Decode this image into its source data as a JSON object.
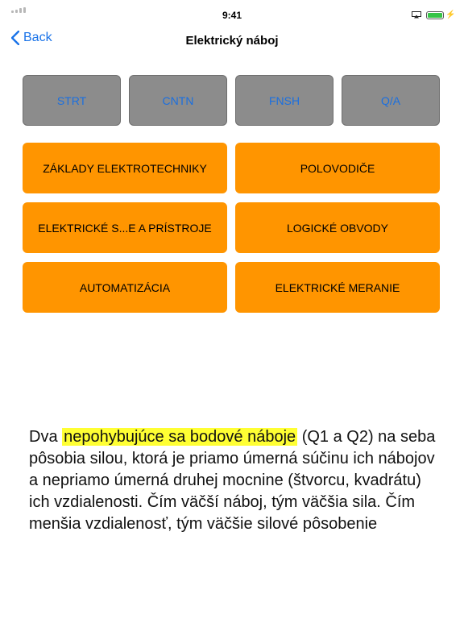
{
  "status_bar": {
    "time": "9:41"
  },
  "nav": {
    "back_label": "Back",
    "title": "Elektrický náboj"
  },
  "top_buttons": [
    {
      "label": "STRT"
    },
    {
      "label": "CNTN"
    },
    {
      "label": "FNSH"
    },
    {
      "label": "Q/A"
    }
  ],
  "categories": [
    {
      "label": "ZÁKLADY ELEKTROTECHNIKY"
    },
    {
      "label": "POLOVODIČE"
    },
    {
      "label": "ELEKTRICKÉ S...E A PRÍSTROJE"
    },
    {
      "label": "LOGICKÉ OBVODY"
    },
    {
      "label": "AUTOMATIZÁCIA"
    },
    {
      "label": "ELEKTRICKÉ MERANIE"
    }
  ],
  "content": {
    "prefix": "Dva ",
    "highlight": "nepohybujúce sa bodové náboje",
    "body": " (Q1 a Q2) na seba pôsobia silou, ktorá je priamo úmerná súčinu ich nábojov a nepriamo úmerná druhej mocnine (štvorcu, kvadrátu) ich vzdialenosti. Čím väčší náboj, tým väčšia sila. Čím menšia vzdialenosť, tým väčšie silové pôsobenie"
  },
  "colors": {
    "accent": "#1a73e8",
    "orange": "#ff9500",
    "gray_button": "#8c8c8c",
    "highlight": "#ffff33",
    "battery": "#36c447"
  },
  "icons": {
    "back": "chevron-left-icon",
    "signal": "signal-icon",
    "airplay": "airplay-icon",
    "battery": "battery-icon",
    "charging": "bolt-icon"
  }
}
